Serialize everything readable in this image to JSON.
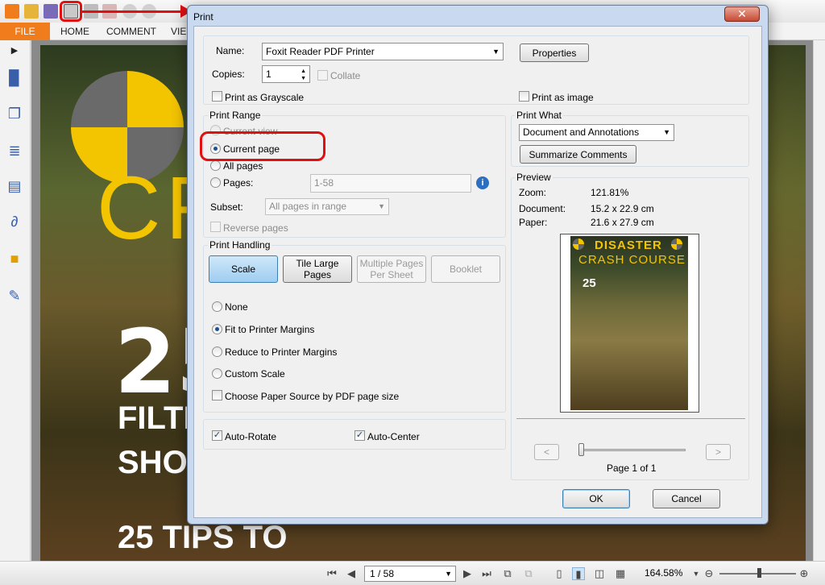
{
  "app": {
    "ribbon_tabs": {
      "file": "FILE",
      "home": "HOME",
      "comment": "COMMENT",
      "view": "VIE"
    },
    "statusbar": {
      "page_indicator": "1 / 58",
      "zoom": "164.58%"
    },
    "document_text": {
      "cr": "CR",
      "n25": "25",
      "filte": "FILTE",
      "shor": "SHOR",
      "tips": "25 TIPS TO"
    },
    "colors": {
      "accent": "#f07c1b",
      "annotation": "#e01010"
    }
  },
  "dialog": {
    "title": "Print",
    "close_glyph": "✕",
    "printer": {
      "name_label": "Name:",
      "name_value": "Foxit Reader PDF Printer",
      "properties_label": "Properties",
      "copies_label": "Copies:",
      "copies_value": "1",
      "collate_label": "Collate",
      "grayscale_label": "Print as Grayscale",
      "print_as_image_label": "Print as image"
    },
    "print_range": {
      "title": "Print Range",
      "current_view": "Current view",
      "current_page": "Current page",
      "all_pages": "All pages",
      "pages": "Pages:",
      "pages_value": "1-58",
      "subset_label": "Subset:",
      "subset_value": "All pages in range",
      "reverse_pages": "Reverse pages",
      "selected": "current_page"
    },
    "print_handling": {
      "title": "Print Handling",
      "buttons": {
        "scale": "Scale",
        "tile_line1": "Tile Large",
        "tile_line2": "Pages",
        "multi_line1": "Multiple Pages",
        "multi_line2": "Per Sheet",
        "booklet": "Booklet"
      },
      "options": {
        "none": "None",
        "fit": "Fit to Printer Margins",
        "reduce": "Reduce to Printer Margins",
        "custom": "Custom Scale",
        "paper_source": "Choose Paper Source by PDF page size"
      },
      "selected": "fit"
    },
    "auto": {
      "rotate": "Auto-Rotate",
      "center": "Auto-Center"
    },
    "print_what": {
      "title": "Print What",
      "value": "Document and Annotations",
      "summarize": "Summarize Comments"
    },
    "preview": {
      "title": "Preview",
      "zoom_label": "Zoom:",
      "zoom_value": "121.81%",
      "document_label": "Document:",
      "document_value": "15.2 x 22.9 cm",
      "paper_label": "Paper:",
      "paper_value": "21.6 x 27.9 cm",
      "thumb_title1": "DISASTER",
      "thumb_title2": "CRASH COURSE",
      "thumb_text": "25",
      "prev": "<",
      "next": ">",
      "page_label": "Page 1 of 1"
    },
    "ok": "OK",
    "cancel": "Cancel"
  }
}
